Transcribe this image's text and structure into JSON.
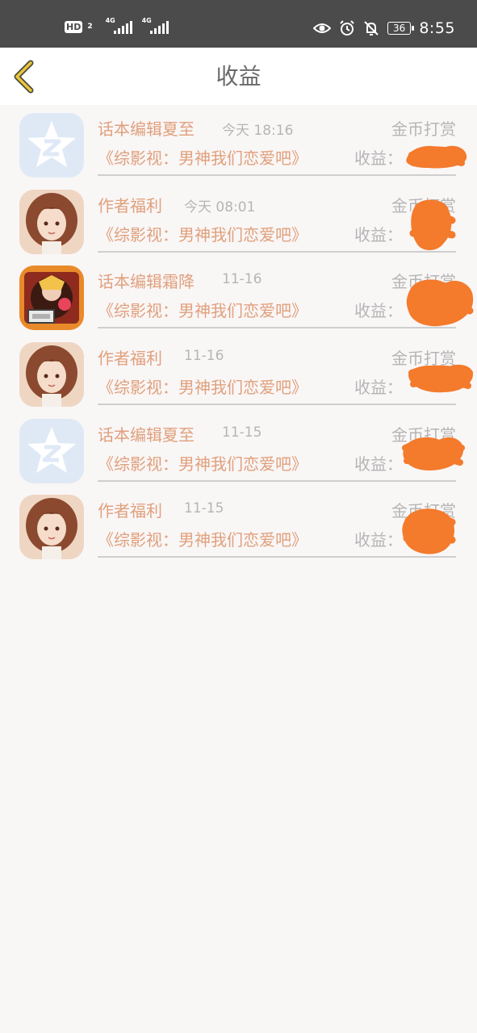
{
  "status_bar": {
    "hd_label": "HD",
    "hd_sub": "2",
    "sim1_label": "4G",
    "sim2_label": "4G",
    "battery": "36",
    "time": "8:55"
  },
  "header": {
    "title": "收益"
  },
  "colors": {
    "accent_text": "#e0a07c",
    "muted_text": "#b5b5b5",
    "redaction": "#f47a2c"
  },
  "records": [
    {
      "sender": "话本编辑夏至",
      "time": "今天 18:16",
      "type": "金币打赏",
      "book": "《综影视：男神我们恋爱吧》",
      "income_label": "收益：",
      "avatar": "qq-star-avatar"
    },
    {
      "sender": "作者福利",
      "time": "今天 08:01",
      "type": "金币打赏",
      "book": "《综影视：男神我们恋爱吧》",
      "income_label": "收益：",
      "avatar": "anime-girl-avatar"
    },
    {
      "sender": "话本编辑霜降",
      "time": "11-16",
      "type": "金币打赏",
      "book": "《综影视：男神我们恋爱吧》",
      "income_label": "收益：",
      "avatar": "editor-shuangjiang-avatar"
    },
    {
      "sender": "作者福利",
      "time": "11-16",
      "type": "金币打赏",
      "book": "《综影视：男神我们恋爱吧》",
      "income_label": "收益：",
      "avatar": "anime-girl-avatar"
    },
    {
      "sender": "话本编辑夏至",
      "time": "11-15",
      "type": "金币打赏",
      "book": "《综影视：男神我们恋爱吧》",
      "income_label": "收益：",
      "avatar": "qq-star-avatar"
    },
    {
      "sender": "作者福利",
      "time": "11-15",
      "type": "金币打赏",
      "book": "《综影视：男神我们恋爱吧》",
      "income_label": "收益：",
      "avatar": "anime-girl-avatar"
    }
  ]
}
